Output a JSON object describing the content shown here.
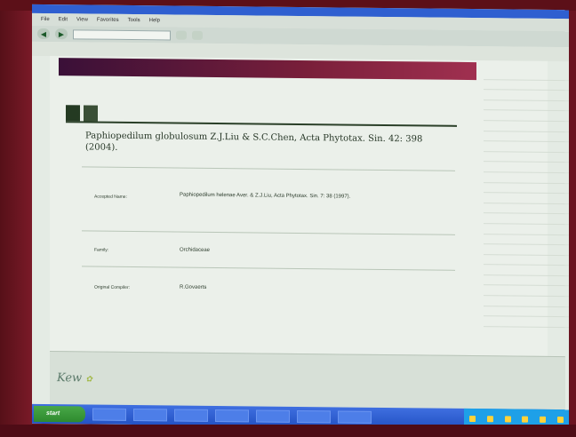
{
  "browser": {
    "title": "",
    "menu": [
      "File",
      "Edit",
      "View",
      "Favorites",
      "Tools",
      "Help"
    ],
    "address": "",
    "tabs": [
      "",
      ""
    ],
    "favorites": [
      "",
      "",
      ""
    ]
  },
  "site": {
    "brand": "",
    "search_link": ""
  },
  "page": {
    "tabs": [
      "",
      ""
    ],
    "title": "Paphiopedilum globulosum Z.J.Liu & S.C.Chen, Acta Phytotax. Sin. 42: 398 (2004).",
    "subtitle": "",
    "fields": [
      {
        "label": "Accepted Name:",
        "value": "Paphiopedilum helenae Aver. & Z.J.Liu, Acta Phytotax. Sin. 7: 38 (1997)."
      },
      {
        "label": "Family:",
        "value": "Orchidaceae"
      },
      {
        "label": "Original Compiler:",
        "value": "R.Govaerts"
      }
    ]
  },
  "sidebar": {
    "items": [
      "",
      "",
      "",
      "",
      "",
      "",
      "",
      "",
      "",
      "",
      "",
      "",
      "",
      "",
      "",
      "",
      "",
      "",
      "",
      "",
      "",
      "",
      "",
      "",
      ""
    ]
  },
  "footer": {
    "logo": "Kew",
    "columns": [
      {
        "heading": "",
        "links": [
          "",
          "",
          ""
        ]
      },
      {
        "heading": "",
        "links": [
          "",
          "",
          ""
        ]
      },
      {
        "heading": "",
        "links": [
          "",
          "",
          ""
        ]
      },
      {
        "heading": "",
        "links": [
          "",
          "",
          ""
        ]
      },
      {
        "heading": "",
        "links": [
          "",
          "",
          ""
        ]
      }
    ]
  },
  "taskbar": {
    "start": "start",
    "tasks": [
      "",
      "",
      "",
      "",
      "",
      "",
      ""
    ]
  },
  "colors": {
    "banner": "#7a1f3a",
    "tab_dark": "#243a22",
    "taskbar": "#2352c4",
    "start": "#2e8a2e"
  }
}
